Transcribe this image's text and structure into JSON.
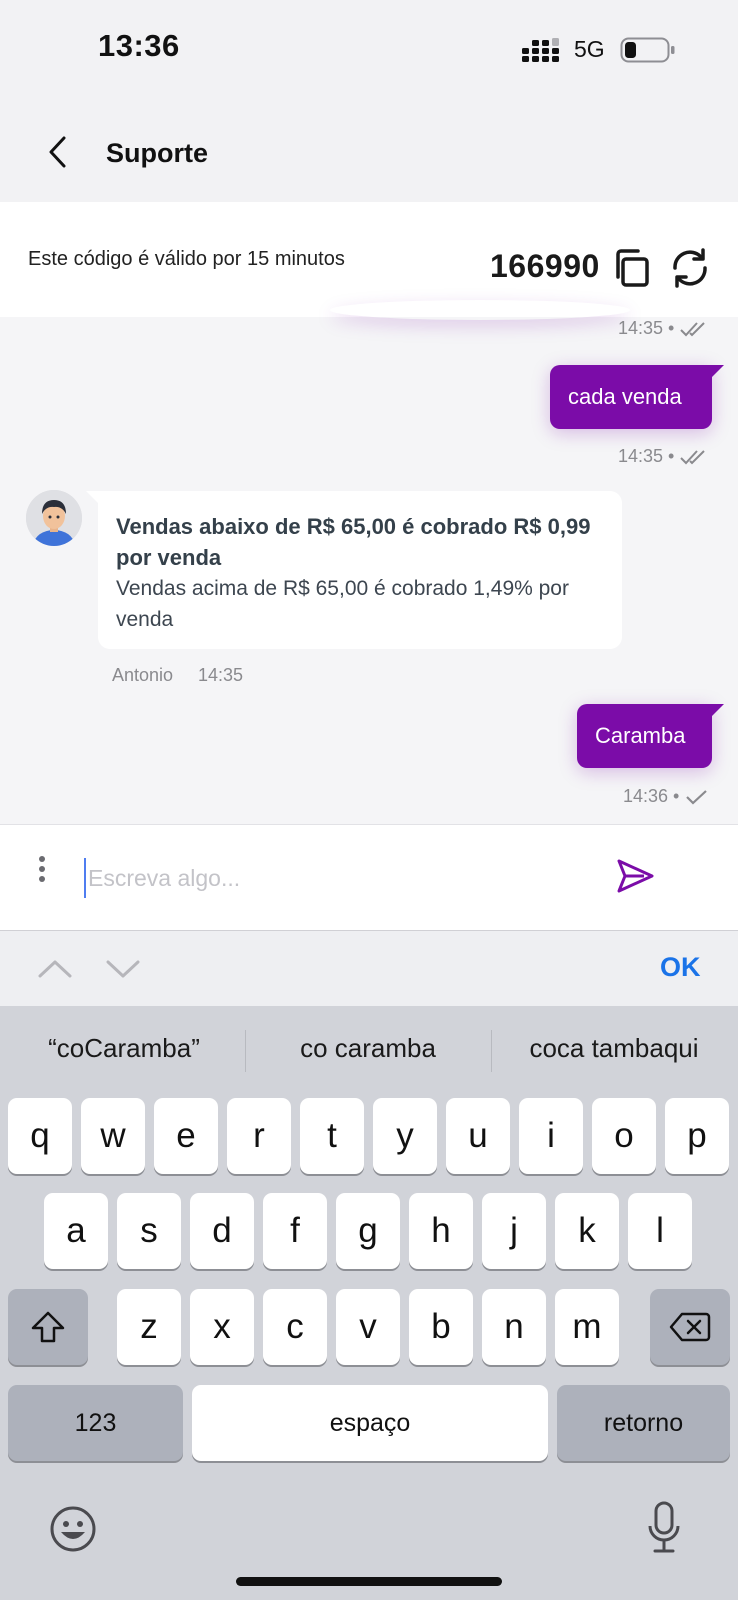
{
  "status_bar": {
    "time": "13:36",
    "network": "5G"
  },
  "header": {
    "title": "Suporte"
  },
  "code_panel": {
    "validity_text": "Este código é válido por 15 minutos",
    "code": "166990"
  },
  "messages": {
    "m1_time": "14:35 •",
    "m2_text": "cada venda",
    "m2_time": "14:35 •",
    "incoming_bold": "Vendas abaixo de R$ 65,00 é cobrado R$ 0,99 por venda",
    "incoming_normal": "Vendas acima de R$ 65,00 é cobrado 1,49% por venda",
    "incoming_sender": "Antonio",
    "incoming_time": "14:35",
    "m3_text": "Caramba",
    "m3_time": "14:36 •"
  },
  "composer": {
    "placeholder": "Escreva algo..."
  },
  "accessory": {
    "ok_label": "OK"
  },
  "keyboard": {
    "suggestions": [
      "“coCaramba”",
      "co caramba",
      "coca tambaqui"
    ],
    "row1": [
      "q",
      "w",
      "e",
      "r",
      "t",
      "y",
      "u",
      "i",
      "o",
      "p"
    ],
    "row2": [
      "a",
      "s",
      "d",
      "f",
      "g",
      "h",
      "j",
      "k",
      "l"
    ],
    "row3": [
      "z",
      "x",
      "c",
      "v",
      "b",
      "n",
      "m"
    ],
    "numbers_label": "123",
    "space_label": "espaço",
    "return_label": "retorno"
  },
  "colors": {
    "brand_purple": "#7b0ca8",
    "link_blue": "#1a73e8"
  },
  "icons": [
    "back-icon",
    "copy-icon",
    "refresh-icon",
    "double-check-icon",
    "check-icon",
    "more-vertical-icon",
    "send-icon",
    "chevron-up-icon",
    "chevron-down-icon",
    "shift-icon",
    "backspace-icon",
    "emoji-icon",
    "microphone-icon"
  ]
}
